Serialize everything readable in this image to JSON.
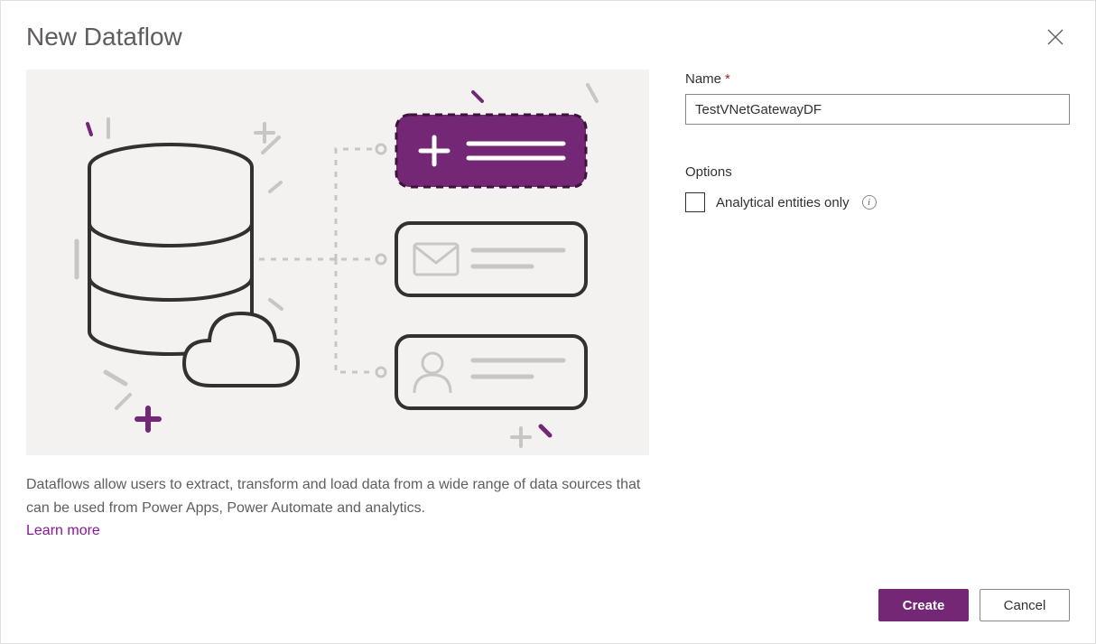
{
  "dialog": {
    "title": "New Dataflow"
  },
  "form": {
    "name_label": "Name",
    "name_value": "TestVNetGatewayDF",
    "options_label": "Options",
    "analytical_label": "Analytical entities only"
  },
  "description": {
    "text": "Dataflows allow users to extract, transform and load data from a wide range of data sources that can be used from Power Apps, Power Automate and analytics.",
    "learn_more": "Learn more"
  },
  "footer": {
    "create_label": "Create",
    "cancel_label": "Cancel"
  },
  "colors": {
    "accent": "#742774",
    "illustration_bg": "#f3f2f1"
  }
}
